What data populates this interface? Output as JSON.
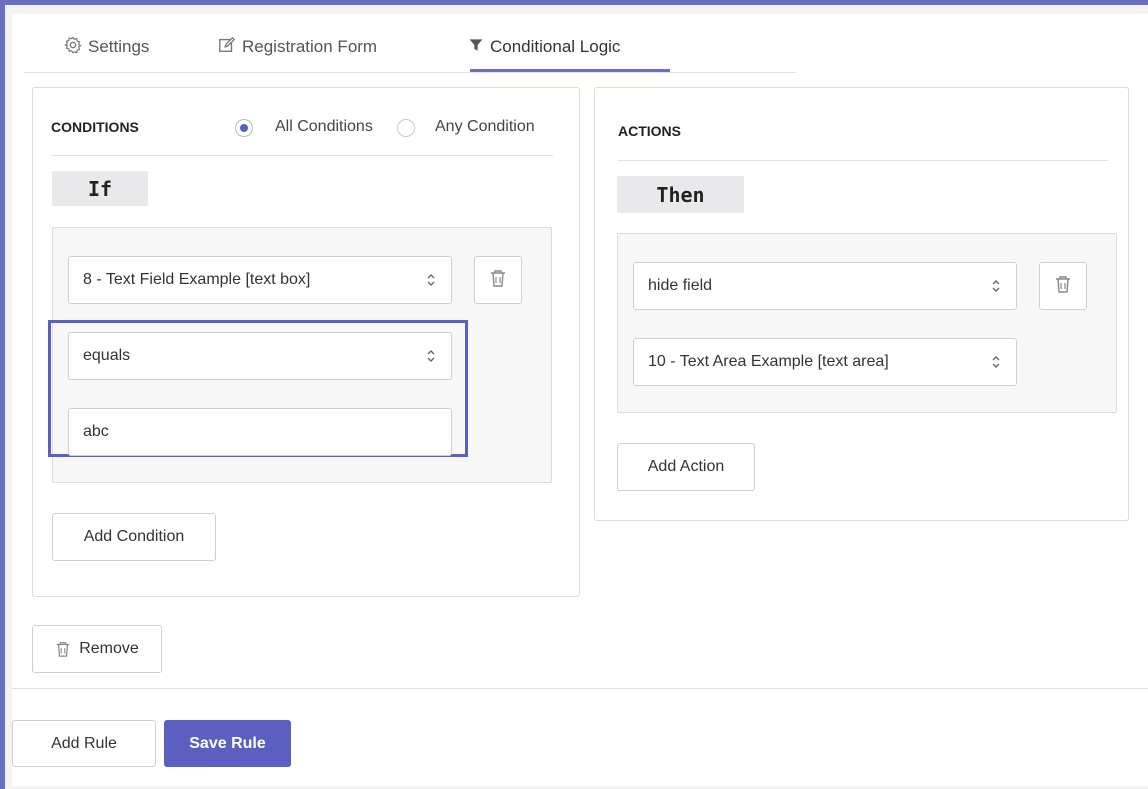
{
  "tabs": [
    {
      "label": "Settings",
      "icon": "gear-icon"
    },
    {
      "label": "Registration Form",
      "icon": "edit-icon"
    },
    {
      "label": "Conditional Logic",
      "icon": "filter-icon",
      "active": true
    }
  ],
  "conditions": {
    "title": "CONDITIONS",
    "match_options": [
      {
        "label": "All Conditions",
        "selected": true
      },
      {
        "label": "Any Condition",
        "selected": false
      }
    ],
    "if_label": "If",
    "field_select": "8 - Text Field Example [text box]",
    "operator_select": "equals",
    "value_input": "abc",
    "add_button": "Add Condition"
  },
  "actions": {
    "title": "ACTIONS",
    "then_label": "Then",
    "action_select": "hide field",
    "target_select": "10 - Text Area Example [text area]",
    "add_button": "Add Action"
  },
  "rule": {
    "remove_button": "Remove",
    "add_rule_button": "Add Rule",
    "save_rule_button": "Save Rule"
  },
  "colors": {
    "accent": "#5a5fc0",
    "frame": "#6b6fc2"
  }
}
